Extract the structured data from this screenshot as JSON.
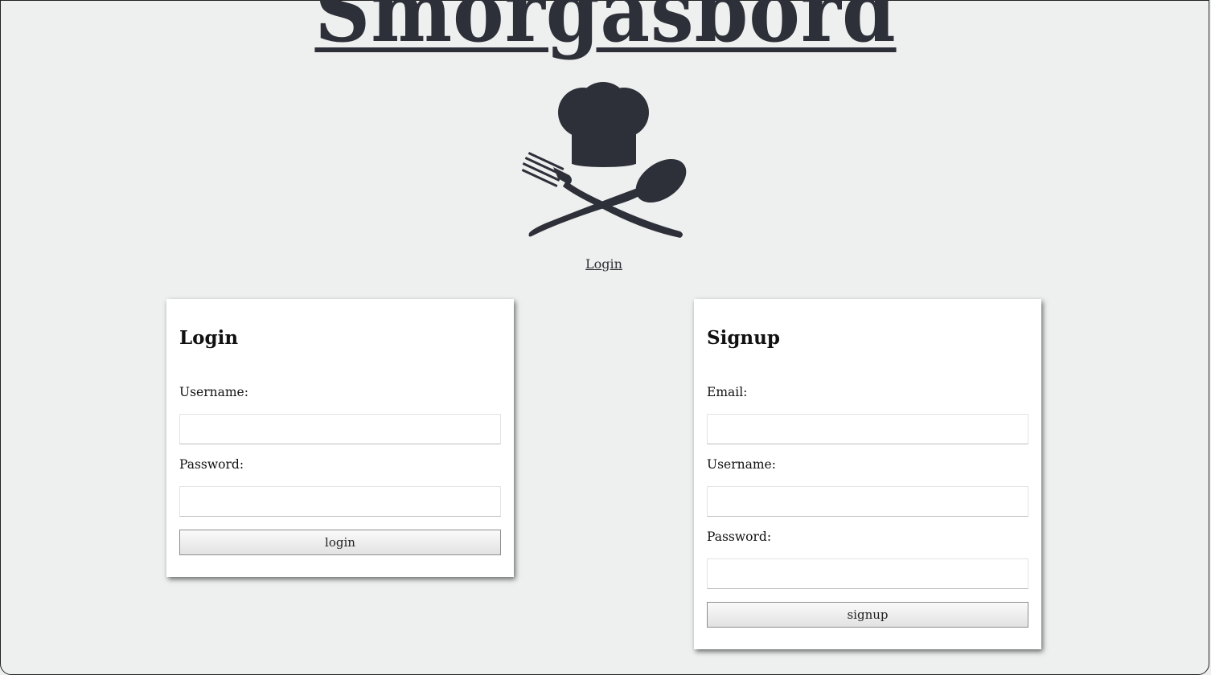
{
  "header": {
    "site_title": "Smorgasbord",
    "logo_icon": "chef-hat-fork-spoon-icon",
    "nav_login_link": "Login"
  },
  "login_form": {
    "title": "Login",
    "username_label": "Username:",
    "username_value": "",
    "password_label": "Password:",
    "password_value": "",
    "submit_label": "login"
  },
  "signup_form": {
    "title": "Signup",
    "email_label": "Email:",
    "email_value": "",
    "username_label": "Username:",
    "username_value": "",
    "password_label": "Password:",
    "password_value": "",
    "submit_label": "signup"
  },
  "colors": {
    "page_background": "#eef0ef",
    "brand_dark": "#2e3039",
    "card_background": "#ffffff"
  }
}
